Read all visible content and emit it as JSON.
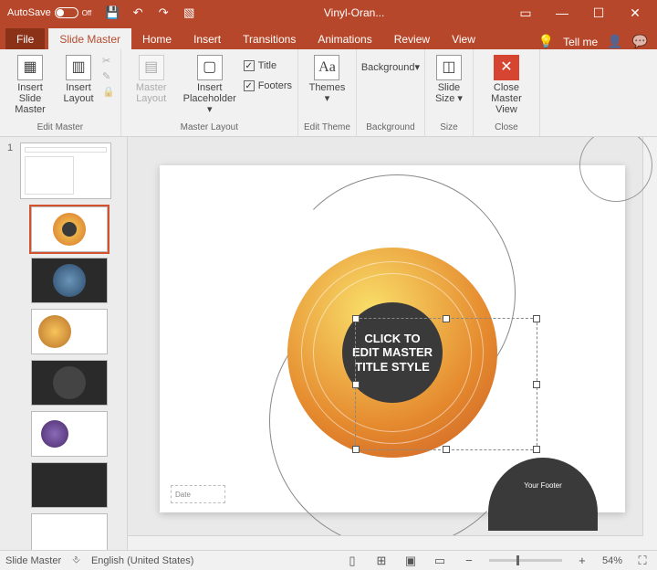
{
  "titlebar": {
    "autosave": "AutoSave",
    "autosave_state": "Off",
    "document": "Vinyl-Oran..."
  },
  "tabs": {
    "file": "File",
    "slideMaster": "Slide Master",
    "home": "Home",
    "insert": "Insert",
    "transitions": "Transitions",
    "animations": "Animations",
    "review": "Review",
    "view": "View",
    "tellMe": "Tell me"
  },
  "ribbon": {
    "editMaster": {
      "insertSlideMaster": "Insert Slide Master",
      "insertLayout": "Insert Layout",
      "label": "Edit Master"
    },
    "masterLayout": {
      "masterLayout": "Master Layout",
      "insertPlaceholder": "Insert Placeholder",
      "title": "Title",
      "footers": "Footers",
      "label": "Master Layout"
    },
    "editTheme": {
      "themes": "Themes",
      "label": "Edit Theme"
    },
    "background": {
      "background": "Background",
      "label": "Background"
    },
    "size": {
      "slideSize": "Slide Size",
      "label": "Size"
    },
    "close": {
      "closeMasterView": "Close Master View",
      "label": "Close"
    }
  },
  "slide": {
    "titlePlaceholder": "CLICK TO EDIT MASTER TITLE STYLE",
    "footer": "Your Footer",
    "date": "Date"
  },
  "thumbs": {
    "num1": "1"
  },
  "status": {
    "mode": "Slide Master",
    "language": "English (United States)",
    "zoom": "54%"
  }
}
